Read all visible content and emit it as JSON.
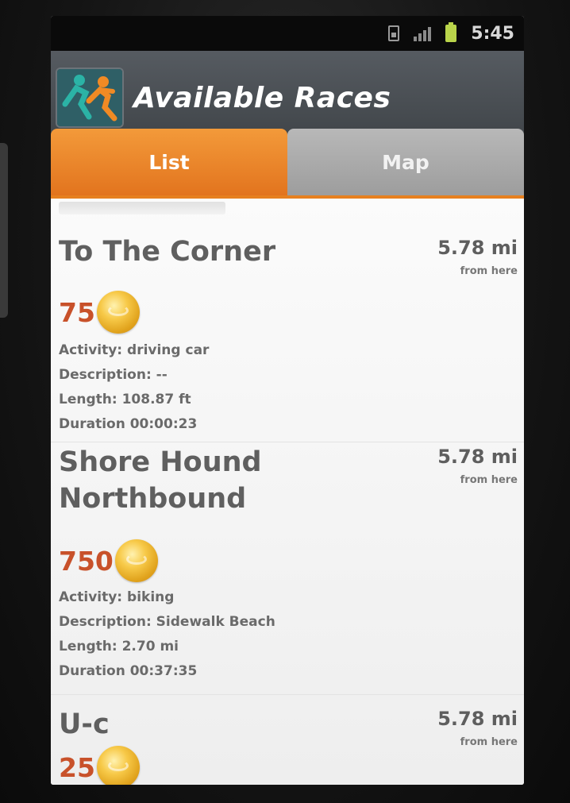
{
  "status_bar": {
    "time": "5:45"
  },
  "header": {
    "title": "Available Races",
    "logo_icon": "runner-logo-icon"
  },
  "tabs": [
    {
      "label": "List",
      "active": true
    },
    {
      "label": "Map",
      "active": false
    }
  ],
  "colors": {
    "accent": "#e6801f",
    "points": "#c8512a",
    "title_bar": "#4a4f54"
  },
  "races": [
    {
      "name": "To The Corner",
      "distance": "5.78 mi",
      "distance_sub": "from here",
      "points": "75",
      "activity": "Activity: driving car",
      "description": "Description: --",
      "length": "Length: 108.87 ft",
      "duration": "Duration 00:00:23"
    },
    {
      "name": "Shore Hound Northbound",
      "distance": "5.78 mi",
      "distance_sub": "from here",
      "points": "750",
      "activity": "Activity: biking",
      "description": "Description: Sidewalk Beach",
      "length": "Length: 2.70 mi",
      "duration": "Duration 00:37:35"
    },
    {
      "name": "U-c",
      "distance": "5.78 mi",
      "distance_sub": "from here",
      "points": "25"
    }
  ]
}
